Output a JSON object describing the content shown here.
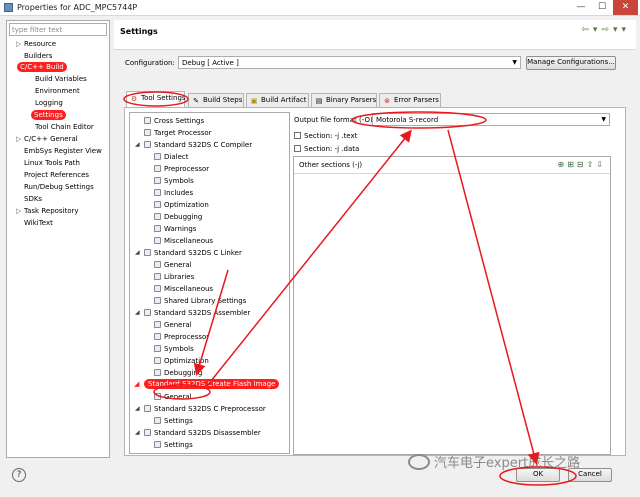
{
  "window": {
    "title": "Properties for ADC_MPC5744P",
    "min": "—",
    "max": "☐",
    "close": "✕"
  },
  "filter": {
    "placeholder": "type filter text"
  },
  "nav": [
    {
      "label": "Resource",
      "twisty": "▷"
    },
    {
      "label": "Builders",
      "twisty": ""
    },
    {
      "label": "C/C++ Build",
      "twisty": "◢"
    },
    {
      "label": "Build Variables",
      "twisty": ""
    },
    {
      "label": "Environment",
      "twisty": ""
    },
    {
      "label": "Logging",
      "twisty": ""
    },
    {
      "label": "Settings",
      "twisty": ""
    },
    {
      "label": "Tool Chain Editor",
      "twisty": ""
    },
    {
      "label": "C/C++ General",
      "twisty": "▷"
    },
    {
      "label": "EmbSys Register View",
      "twisty": ""
    },
    {
      "label": "Linux Tools Path",
      "twisty": ""
    },
    {
      "label": "Project References",
      "twisty": ""
    },
    {
      "label": "Run/Debug Settings",
      "twisty": ""
    },
    {
      "label": "SDKs",
      "twisty": ""
    },
    {
      "label": "Task Repository",
      "twisty": "▷"
    },
    {
      "label": "WikiText",
      "twisty": ""
    }
  ],
  "header": {
    "title": "Settings",
    "nav_buttons": "⇦▾⇨▾▾"
  },
  "configuration": {
    "label": "Configuration:",
    "value": "Debug  [ Active ]",
    "manage_label": "Manage Configurations..."
  },
  "tabs": [
    {
      "label": "Tool Settings",
      "icon": "⚙"
    },
    {
      "label": "Build Steps",
      "icon": "✎"
    },
    {
      "label": "Build Artifact",
      "icon": "▣"
    },
    {
      "label": "Binary Parsers",
      "icon": "▤"
    },
    {
      "label": "Error Parsers",
      "icon": "⊗"
    }
  ],
  "tree": [
    {
      "label": "Cross Settings",
      "twisty": ""
    },
    {
      "label": "Target Processor",
      "twisty": ""
    },
    {
      "label": "Standard S32DS C Compiler",
      "twisty": "◢"
    },
    {
      "label": "Dialect",
      "twisty": ""
    },
    {
      "label": "Preprocessor",
      "twisty": ""
    },
    {
      "label": "Symbols",
      "twisty": ""
    },
    {
      "label": "Includes",
      "twisty": ""
    },
    {
      "label": "Optimization",
      "twisty": ""
    },
    {
      "label": "Debugging",
      "twisty": ""
    },
    {
      "label": "Warnings",
      "twisty": ""
    },
    {
      "label": "Miscellaneous",
      "twisty": ""
    },
    {
      "label": "Standard S32DS C Linker",
      "twisty": "◢"
    },
    {
      "label": "General",
      "twisty": ""
    },
    {
      "label": "Libraries",
      "twisty": ""
    },
    {
      "label": "Miscellaneous",
      "twisty": ""
    },
    {
      "label": "Shared Library Settings",
      "twisty": ""
    },
    {
      "label": "Standard S32DS Assembler",
      "twisty": "◢"
    },
    {
      "label": "General",
      "twisty": ""
    },
    {
      "label": "Preprocessor",
      "twisty": ""
    },
    {
      "label": "Symbols",
      "twisty": ""
    },
    {
      "label": "Optimization",
      "twisty": ""
    },
    {
      "label": "Debugging",
      "twisty": ""
    },
    {
      "label": "Standard S32DS Create Flash Image",
      "twisty": "◢"
    },
    {
      "label": "General",
      "twisty": ""
    },
    {
      "label": "Standard S32DS C Preprocessor",
      "twisty": "◢"
    },
    {
      "label": "Settings",
      "twisty": ""
    },
    {
      "label": "Standard S32DS Disassembler",
      "twisty": "◢"
    },
    {
      "label": "Settings",
      "twisty": ""
    }
  ],
  "output": {
    "label": "Output file format (-O)",
    "value": "Motorola S-record"
  },
  "checks": [
    {
      "label": "Section: -j .text",
      "checked": false
    },
    {
      "label": "Section: -j .data",
      "checked": false
    }
  ],
  "other_sections": {
    "label": "Other sections (-j)",
    "tools": "⊕⊞⊟⇧⇩"
  },
  "buttons": {
    "help": "?",
    "ok": "OK",
    "cancel": "Cancel"
  },
  "watermark": "汽车电子expert成长之路",
  "colors": {
    "highlight": "#ff1f1f",
    "arrow": "#e8181c",
    "tab_icon": "#c0392b"
  }
}
